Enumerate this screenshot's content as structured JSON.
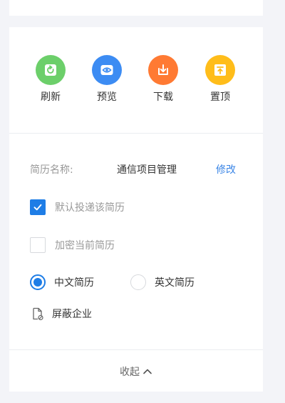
{
  "actions": [
    {
      "label": "刷新",
      "icon": "refresh-icon",
      "color": "#6ccf6a"
    },
    {
      "label": "预览",
      "icon": "eye-icon",
      "color": "#3c8cf3"
    },
    {
      "label": "下载",
      "icon": "download-icon",
      "color": "#ff7a33"
    },
    {
      "label": "置顶",
      "icon": "pin-top-icon",
      "color": "#ffbd1a"
    }
  ],
  "resume": {
    "name_label": "简历名称:",
    "name_value": "通信项目管理",
    "modify_label": "修改"
  },
  "options": {
    "default_delivery": {
      "label": "默认投递该简历",
      "checked": true
    },
    "encrypt": {
      "label": "加密当前简历",
      "checked": false
    }
  },
  "language": {
    "chinese_label": "中文简历",
    "english_label": "英文简历",
    "selected": "中文简历"
  },
  "block_company": {
    "label": "屏蔽企业",
    "icon": "document-block-icon"
  },
  "footer": {
    "collapse_label": "收起",
    "icon": "chevron-up-icon"
  },
  "colors": {
    "accent": "#1e7de6",
    "link": "#3a85e6",
    "muted_text": "#999999",
    "text": "#333333"
  }
}
